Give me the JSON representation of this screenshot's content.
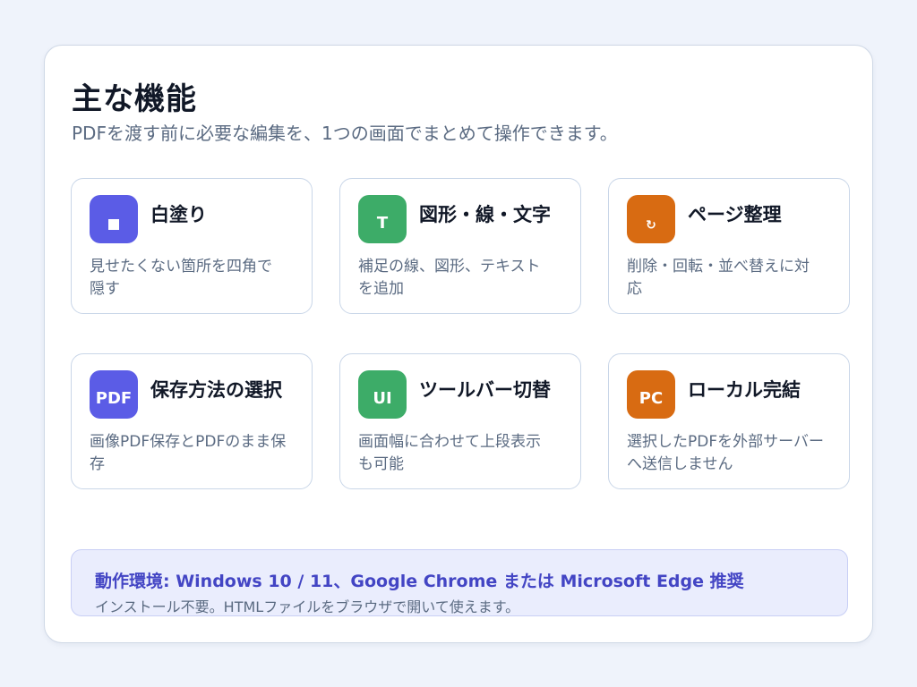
{
  "header": {
    "title": "主な機能",
    "subtitle": "PDFを渡す前に必要な編集を、1つの画面でまとめて操作できます。"
  },
  "features": [
    {
      "title": "白塗り",
      "desc": "見せたくない箇所を四角で隠す",
      "icon_name": "white-square-icon",
      "icon_text": "",
      "color": "#5b5ce6"
    },
    {
      "title": "図形・線・文字",
      "desc": "補足の線、図形、テキストを追加",
      "icon_name": "text-tool-icon",
      "icon_text": "T",
      "color": "#3dac68"
    },
    {
      "title": "ページ整理",
      "desc": "削除・回転・並べ替えに対応",
      "icon_name": "rotate-icon",
      "icon_text": "↻",
      "color": "#d86b12"
    },
    {
      "title": "保存方法の選択",
      "desc": "画像PDF保存とPDFのまま保存",
      "icon_name": "pdf-icon",
      "icon_text": "PDF",
      "color": "#5b5ce6"
    },
    {
      "title": "ツールバー切替",
      "desc": "画面幅に合わせて上段表示も可能",
      "icon_name": "ui-icon",
      "icon_text": "UI",
      "color": "#3dac68"
    },
    {
      "title": "ローカル完結",
      "desc": "選択したPDFを外部サーバーへ送信しません",
      "icon_name": "pc-icon",
      "icon_text": "PC",
      "color": "#d86b12"
    }
  ],
  "environment": {
    "title": "動作環境: Windows 10 / 11、Google Chrome または Microsoft Edge 推奨",
    "note": "インストール不要。HTMLファイルをブラウザで開いて使えます。"
  },
  "colors": {
    "background": "#eff3fb",
    "accent_purple": "#5b5ce6",
    "accent_green": "#3dac68",
    "accent_orange": "#d86b12",
    "env_text": "#4345c4"
  }
}
